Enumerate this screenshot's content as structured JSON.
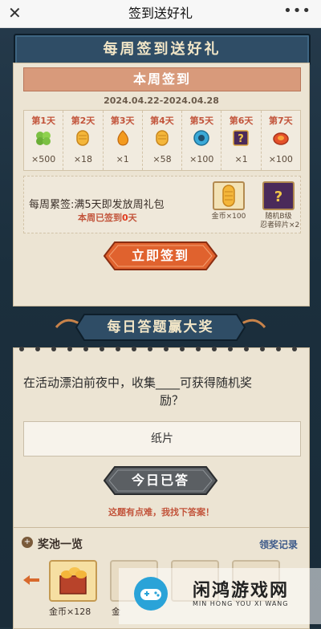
{
  "nav": {
    "title": "签到送好礼",
    "close": "✕",
    "more": "•••"
  },
  "weekly": {
    "banner": "每周签到送好礼",
    "title": "本周签到",
    "date_range": "2024.04.22-2024.04.28",
    "days": [
      {
        "label": "第1天",
        "icon": "green-clover-icon",
        "count": "×500"
      },
      {
        "label": "第2天",
        "icon": "gold-coin-icon",
        "count": "×18"
      },
      {
        "label": "第3天",
        "icon": "orange-drop-icon",
        "count": "×1"
      },
      {
        "label": "第4天",
        "icon": "gold-coin-icon",
        "count": "×58"
      },
      {
        "label": "第5天",
        "icon": "blue-orb-icon",
        "count": "×100"
      },
      {
        "label": "第6天",
        "icon": "mystery-box-icon",
        "count": "×1"
      },
      {
        "label": "第7天",
        "icon": "red-gem-icon",
        "count": "×100"
      }
    ],
    "bonus_title": "每周累签:满5天即发放周礼包",
    "bonus_prefix": "本周已签到",
    "bonus_days": "0",
    "bonus_suffix": "天",
    "rewards": [
      {
        "caption": "金币×100"
      },
      {
        "caption1": "随机B级",
        "caption2": "忍者碎片×2"
      }
    ],
    "sign_button": "立即签到"
  },
  "quiz": {
    "banner": "每日答题赢大奖",
    "question_line1": "在活动漂泊前夜中，收集____可获得随机奖",
    "question_line2": "励？",
    "answer": "纸片",
    "answered_button": "今日已答",
    "help_link": "这题有点难，我找下答案！"
  },
  "pool": {
    "title": "奖池一览",
    "record_link": "领奖记录",
    "items": [
      {
        "caption": "金币×128"
      },
      {
        "caption": "金"
      }
    ]
  },
  "watermark": {
    "name": "闲鸿游戏网",
    "sub": "MIN HONG YOU XI WANG"
  },
  "colors": {
    "accent": "#e0622e",
    "danger": "#c2543b",
    "panel": "#ece4d3",
    "bg": "#1f3340"
  }
}
